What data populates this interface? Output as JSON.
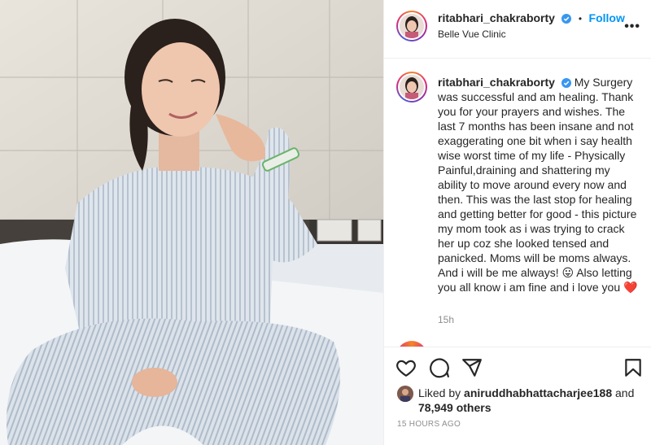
{
  "post": {
    "username": "ritabhari_chakraborty",
    "verified_icon": "verified-badge-icon",
    "dot": "•",
    "follow_label": "Follow",
    "location": "Belle Vue Clinic",
    "more_label": "•••",
    "caption": "My Surgery was successful and am healing. Thank you for your prayers and wishes. The last 7 months has been insane and not exaggerating one bit when i say health wise worst time of my life - Physically Painful,draining and shattering my ability to move around every now and then. This was the last stop for healing and getting better for good - this picture my mom took as i was trying to crack her up coz she looked tensed and panicked. Moms will be moms always. And i will be me always! 😛 Also letting you all know i am fine and i love you",
    "caption_heart": "❤️",
    "time_relative": "15h",
    "liked_by_prefix": "Liked by",
    "liked_by_user": "aniruddhabhattacharjee188",
    "liked_by_and": "and",
    "likes_count": "78,949 others",
    "posted_time": "15 HOURS AGO"
  },
  "actions": {
    "icons": [
      "heart-icon",
      "comment-icon",
      "share-icon",
      "bookmark-icon"
    ]
  },
  "colors": {
    "accent": "#0095f6",
    "heart": "#ed1c24",
    "verified": "#3897f0",
    "muted": "#8e8e8e"
  }
}
